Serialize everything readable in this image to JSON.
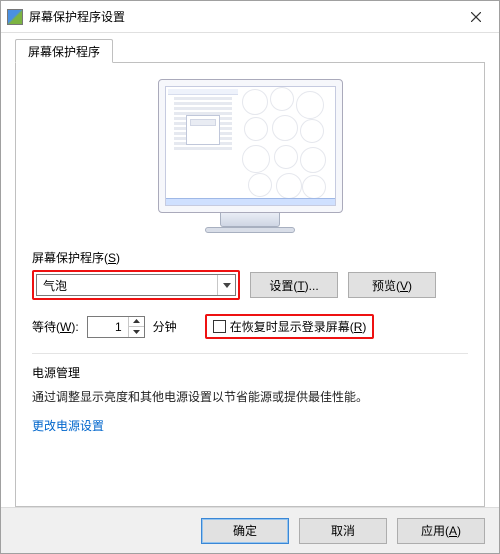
{
  "window": {
    "title": "屏幕保护程序设置",
    "close_label": "关闭"
  },
  "tab": {
    "label": "屏幕保护程序"
  },
  "screensaver": {
    "label_prefix": "屏幕保护程序(",
    "label_mn": "S",
    "label_suffix": ")",
    "selected": "气泡",
    "settings_btn_prefix": "设置(",
    "settings_btn_mn": "T",
    "settings_btn_suffix": ")...",
    "preview_btn_prefix": "预览(",
    "preview_btn_mn": "V",
    "preview_btn_suffix": ")"
  },
  "wait": {
    "label_prefix": "等待(",
    "label_mn": "W",
    "label_suffix": "):",
    "value": "1",
    "unit": "分钟",
    "checkbox_prefix": "在恢复时显示登录屏幕(",
    "checkbox_mn": "R",
    "checkbox_suffix": ")",
    "checkbox_checked": false
  },
  "power": {
    "title": "电源管理",
    "body": "通过调整显示亮度和其他电源设置以节省能源或提供最佳性能。",
    "link": "更改电源设置"
  },
  "buttons": {
    "ok": "确定",
    "cancel": "取消",
    "apply_prefix": "应用(",
    "apply_mn": "A",
    "apply_suffix": ")"
  }
}
